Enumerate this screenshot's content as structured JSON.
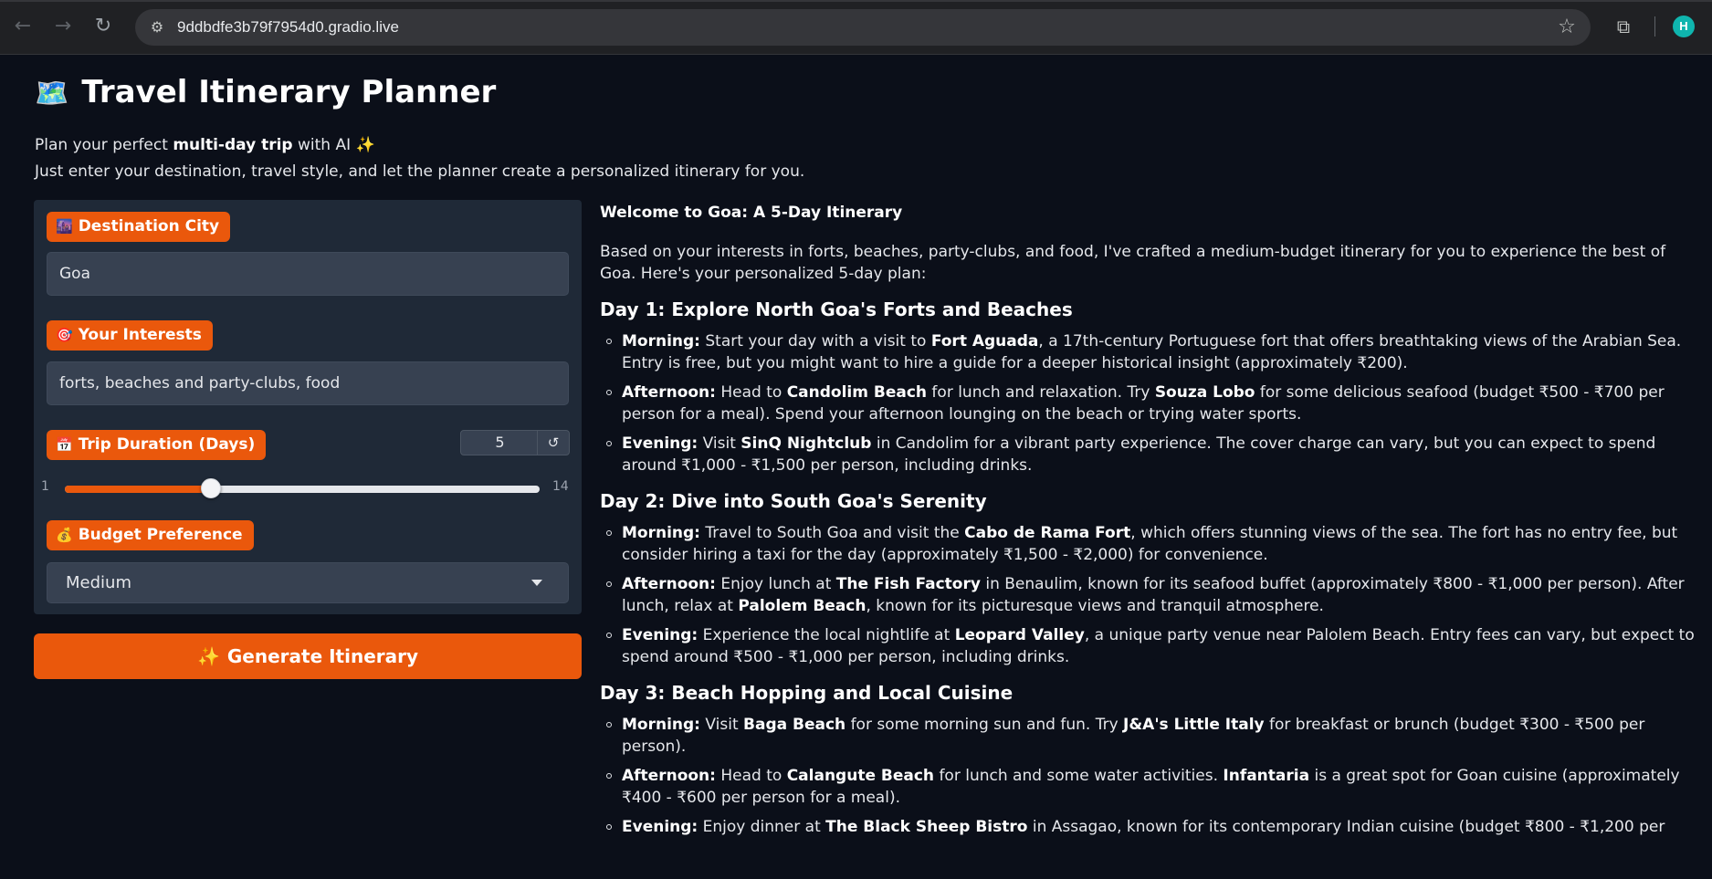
{
  "browser": {
    "url": "9ddbdfe3b79f7954d0.gradio.live",
    "profile_initial": "H",
    "icons": [
      "back-icon",
      "forward-icon",
      "reload-icon",
      "site-settings-icon",
      "bookmark-star-icon",
      "extensions-icon"
    ]
  },
  "app": {
    "title_icon": "🗺️",
    "title": "Travel Itinerary Planner",
    "intro_prefix": "Plan your perfect ",
    "intro_bold": "multi-day trip",
    "intro_suffix": " with AI ✨",
    "intro_line2": "Just enter your destination, travel style, and let the planner create a personalized itinerary for you."
  },
  "form": {
    "destination": {
      "icon": "🌆",
      "label": "Destination City",
      "value": "Goa"
    },
    "interests": {
      "icon": "🎯",
      "label": "Your Interests",
      "value": "forts, beaches and party-clubs, food"
    },
    "duration": {
      "icon": "📅",
      "label": "Trip Duration (Days)",
      "value": "5",
      "reset_icon": "↺",
      "min": "1",
      "max": "14",
      "min_num": 1,
      "max_num": 14,
      "current": 5
    },
    "budget": {
      "icon": "💰",
      "label": "Budget Preference",
      "value": "Medium"
    },
    "generate": {
      "icon": "✨",
      "label": "Generate Itinerary"
    }
  },
  "output": {
    "heading": "Welcome to Goa: A 5-Day Itinerary",
    "intro": "Based on your interests in forts, beaches, party-clubs, and food, I've crafted a medium-budget itinerary for you to experience the best of Goa. Here's your personalized 5-day plan:",
    "days": [
      {
        "title": "Day 1: Explore North Goa's Forts and Beaches",
        "items": [
          {
            "label": "Morning:",
            "parts": [
              " Start your day with a visit to ",
              {
                "b": "Fort Aguada"
              },
              ", a 17th-century Portuguese fort that offers breathtaking views of the Arabian Sea. Entry is free, but you might want to hire a guide for a deeper historical insight (approximately ₹200)."
            ]
          },
          {
            "label": "Afternoon:",
            "parts": [
              " Head to ",
              {
                "b": "Candolim Beach"
              },
              " for lunch and relaxation. Try ",
              {
                "b": "Souza Lobo"
              },
              " for some delicious seafood (budget ₹500 - ₹700 per person for a meal). Spend your afternoon lounging on the beach or trying water sports."
            ]
          },
          {
            "label": "Evening:",
            "parts": [
              " Visit ",
              {
                "b": "SinQ Nightclub"
              },
              " in Candolim for a vibrant party experience. The cover charge can vary, but you can expect to spend around ₹1,000 - ₹1,500 per person, including drinks."
            ]
          }
        ]
      },
      {
        "title": "Day 2: Dive into South Goa's Serenity",
        "items": [
          {
            "label": "Morning:",
            "parts": [
              " Travel to South Goa and visit the ",
              {
                "b": "Cabo de Rama Fort"
              },
              ", which offers stunning views of the sea. The fort has no entry fee, but consider hiring a taxi for the day (approximately ₹1,500 - ₹2,000) for convenience."
            ]
          },
          {
            "label": "Afternoon:",
            "parts": [
              " Enjoy lunch at ",
              {
                "b": "The Fish Factory"
              },
              " in Benaulim, known for its seafood buffet (approximately ₹800 - ₹1,000 per person). After lunch, relax at ",
              {
                "b": "Palolem Beach"
              },
              ", known for its picturesque views and tranquil atmosphere."
            ]
          },
          {
            "label": "Evening:",
            "parts": [
              " Experience the local nightlife at ",
              {
                "b": "Leopard Valley"
              },
              ", a unique party venue near Palolem Beach. Entry fees can vary, but expect to spend around ₹500 - ₹1,000 per person, including drinks."
            ]
          }
        ]
      },
      {
        "title": "Day 3: Beach Hopping and Local Cuisine",
        "items": [
          {
            "label": "Morning:",
            "parts": [
              " Visit ",
              {
                "b": "Baga Beach"
              },
              " for some morning sun and fun. Try ",
              {
                "b": "J&A's Little Italy"
              },
              " for breakfast or brunch (budget ₹300 - ₹500 per person)."
            ]
          },
          {
            "label": "Afternoon:",
            "parts": [
              " Head to ",
              {
                "b": "Calangute Beach"
              },
              " for lunch and some water activities. ",
              {
                "b": "Infantaria"
              },
              " is a great spot for Goan cuisine (approximately ₹400 - ₹600 per person for a meal)."
            ]
          },
          {
            "label": "Evening:",
            "parts": [
              " Enjoy dinner at ",
              {
                "b": "The Black Sheep Bistro"
              },
              " in Assagao, known for its contemporary Indian cuisine (budget ₹800 - ₹1,200 per"
            ]
          }
        ]
      }
    ]
  }
}
